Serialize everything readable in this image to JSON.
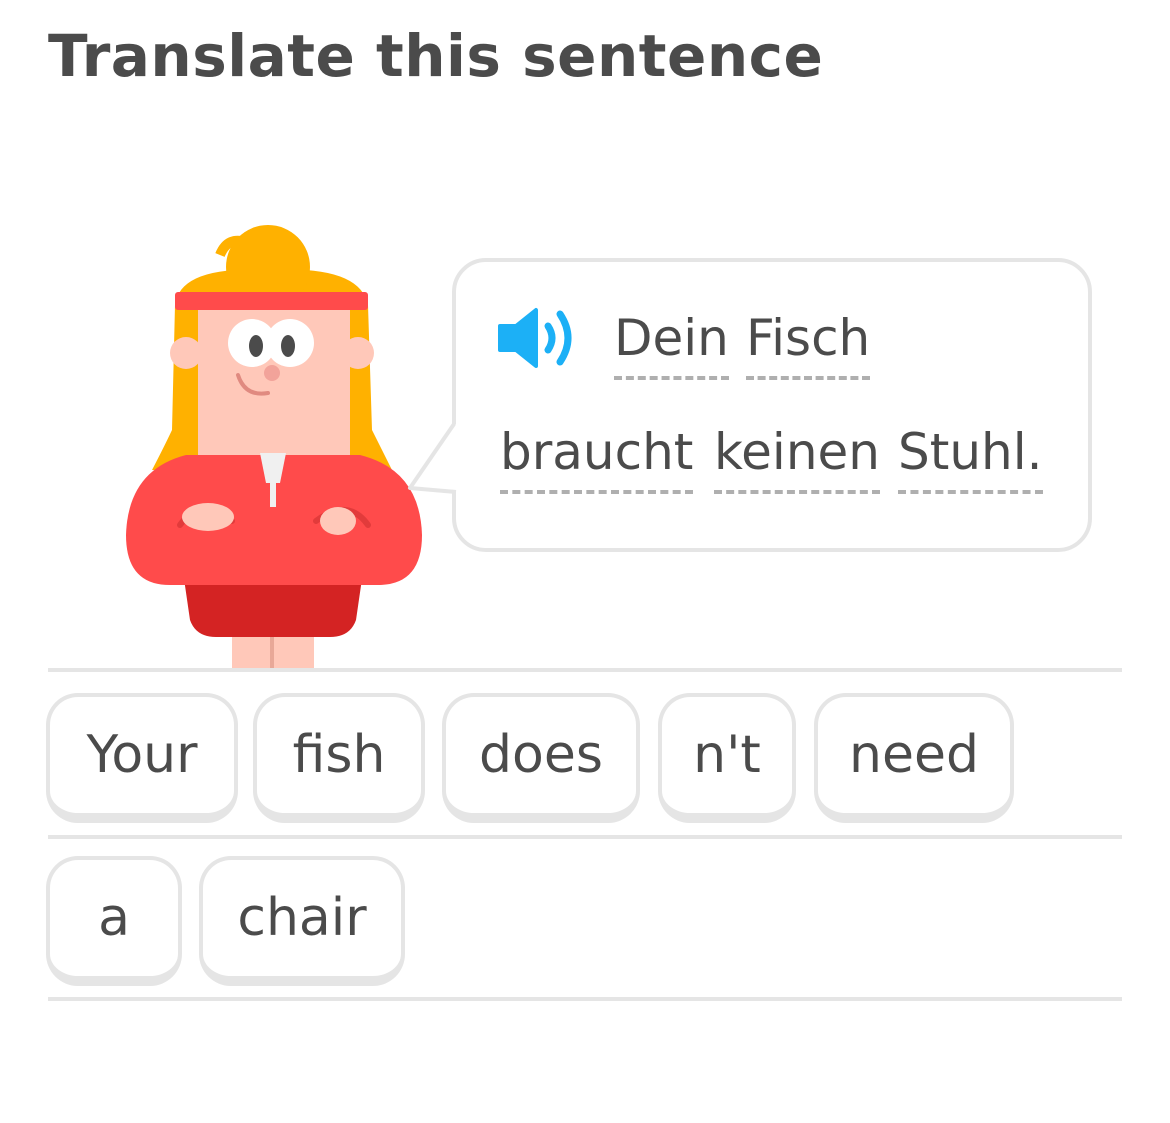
{
  "header": {
    "title": "Translate this sentence"
  },
  "prompt": {
    "speaker_icon": "speaker-icon",
    "words": [
      "Dein",
      "Fisch",
      "braucht",
      "keinen",
      "Stuhl."
    ]
  },
  "answer": {
    "chips": [
      "Your",
      "fish",
      "does",
      "n't",
      "need",
      "a",
      "chair"
    ]
  },
  "colors": {
    "text": "#4b4b4b",
    "border": "#e5e5e5",
    "dashed_underline": "#afafaf",
    "speaker_blue": "#1cb0f6",
    "character_shirt": "#ff4b4b",
    "character_hair": "#ffb100"
  }
}
